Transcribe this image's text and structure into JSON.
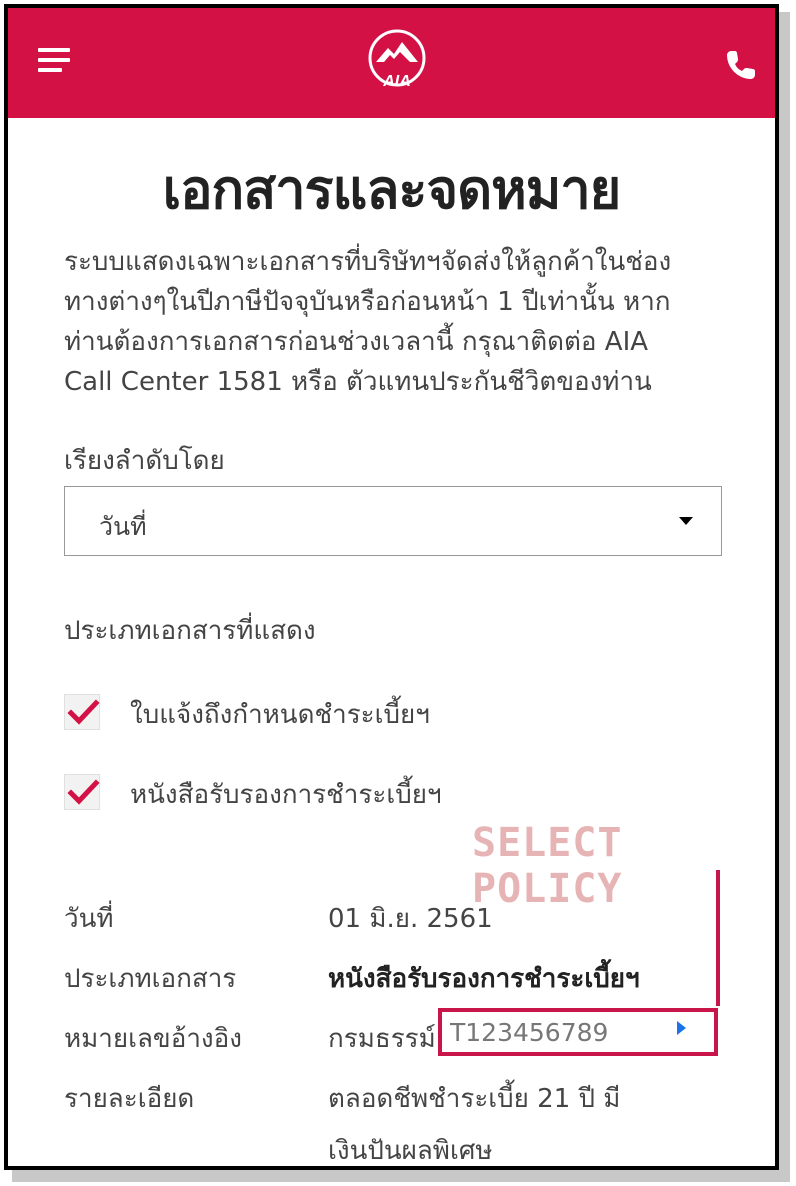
{
  "header": {
    "menu_icon": "hamburger-menu-icon",
    "logo_text": "AIA",
    "phone_icon": "phone-icon",
    "brand_color": "#d31145"
  },
  "page": {
    "title": "เอกสารและจดหมาย",
    "intro_lines": [
      "ระบบแสดงเฉพาะเอกสารที่บริษัทฯจัดส่งให้ลูกค้าในช่อง",
      "ทางต่างๆในปีภาษีปัจจุบันหรือก่อนหน้า 1 ปีเท่านั้น หาก",
      "ท่านต้องการเอกสารก่อนช่วงเวลานี้ กรุณาติดต่อ AIA",
      "Call Center 1581 หรือ ตัวแทนประกันชีวิตของท่าน"
    ]
  },
  "sort": {
    "label": "เรียงลำดับโดย",
    "selected": "วันที่"
  },
  "doc_types": {
    "label": "ประเภทเอกสารที่แสดง",
    "options": [
      {
        "label": "ใบแจ้งถึงกำหนดชำระเบี้ยฯ",
        "checked": true
      },
      {
        "label": "หนังสือรับรองการชำระเบี้ยฯ",
        "checked": true
      }
    ],
    "check_color": "#d31145"
  },
  "annotation": {
    "text": "SELECT POLICY",
    "color": "#c8154a"
  },
  "document": {
    "date_label": "วันที่",
    "date_value": "01 มิ.ย. 2561",
    "type_label": "ประเภทเอกสาร",
    "type_value": "หนังสือรับรองการชำระเบี้ยฯ",
    "ref_label": "หมายเลขอ้างอิง",
    "ref_prefix": "กรมธรรม์",
    "ref_value": "T123456789",
    "detail_label": "รายละเอียด",
    "detail_lines": [
      "ตลอดชีพชำระเบี้ย 21 ปี มี",
      "เงินปันผลพิเศษ"
    ]
  }
}
